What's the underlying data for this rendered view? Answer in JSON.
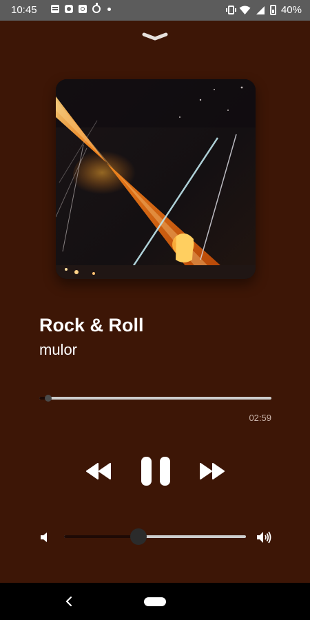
{
  "status_bar": {
    "time": "10:45",
    "battery": "40%",
    "left_icons": [
      "news-icon",
      "flipboard-icon",
      "camera-app-icon",
      "timer-icon",
      "dot-icon"
    ],
    "right_icons": [
      "vibrate-icon",
      "wifi-icon",
      "signal-icon",
      "battery-icon"
    ]
  },
  "player": {
    "collapse_icon": "chevron-down-icon",
    "album_art": "concert-stage-spotlight",
    "title": "Rock & Roll",
    "artist": "mulor",
    "duration": "02:59",
    "progress": 0.04,
    "volume": 0.41
  },
  "controls": {
    "previous_icon": "rewind-icon",
    "play_pause_icon": "pause-icon",
    "next_icon": "fast-forward-icon",
    "volume_low_icon": "volume-low-icon",
    "volume_high_icon": "volume-high-icon"
  },
  "nav_bar": {
    "back_icon": "back-chevron-icon",
    "home_icon": "home-pill-icon"
  },
  "colors": {
    "background": "#3d1606",
    "status_bar": "#5c5c5c",
    "track": "#cdcdcd",
    "track_fill": "#1e0a05",
    "spotlight": "#ff8a1e"
  }
}
